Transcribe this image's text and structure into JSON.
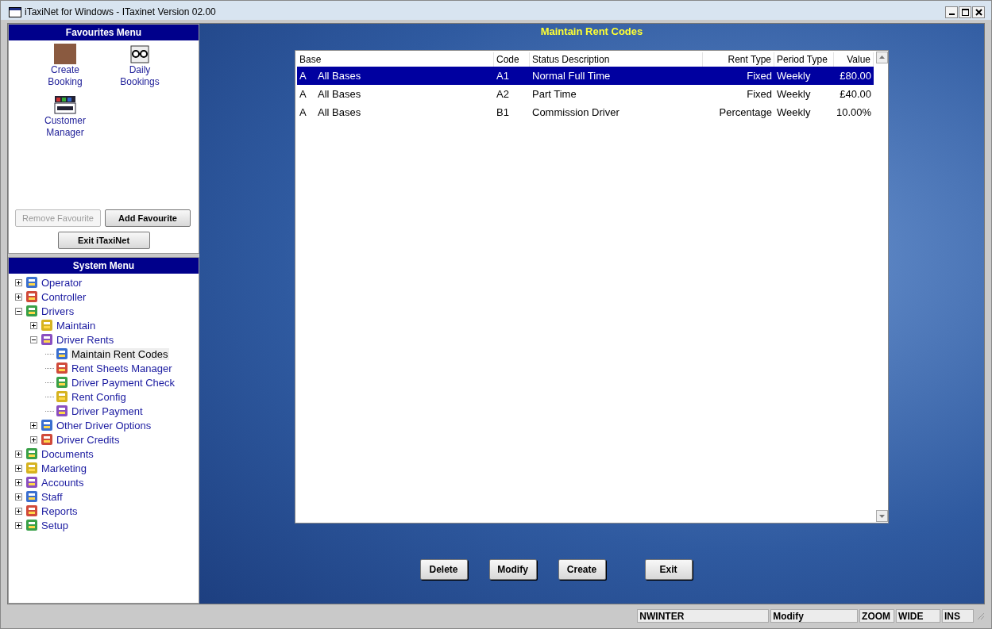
{
  "window": {
    "title": "iTaxiNet for Windows - ITaxinet Version 02.00"
  },
  "favourites": {
    "title": "Favourites Menu",
    "items": [
      {
        "label": "Create Booking",
        "kind": "photo"
      },
      {
        "label": "Daily Bookings",
        "kind": "glasses"
      },
      {
        "label": "Customer Manager",
        "kind": "index"
      }
    ],
    "buttons": [
      {
        "label": "Remove Favourite",
        "disabled": true
      },
      {
        "label": "Add Favourite",
        "disabled": false
      }
    ],
    "exit_button": "Exit iTaxiNet"
  },
  "system_menu": {
    "title": "System Menu",
    "items": [
      {
        "label": "Operator",
        "expanded": false,
        "selected": false
      },
      {
        "label": "Controller",
        "expanded": false,
        "selected": false
      },
      {
        "label": "Drivers",
        "expanded": true,
        "selected": false,
        "children": [
          {
            "label": "Maintain",
            "expanded": false,
            "selected": false
          },
          {
            "label": "Driver Rents",
            "expanded": true,
            "selected": false,
            "children": [
              {
                "label": "Maintain Rent Codes",
                "selected": true
              },
              {
                "label": "Rent Sheets Manager",
                "selected": false
              },
              {
                "label": "Driver Payment Check",
                "selected": false
              },
              {
                "label": "Rent Config",
                "selected": false
              },
              {
                "label": "Driver Payment",
                "selected": false
              }
            ]
          },
          {
            "label": "Other Driver Options",
            "expanded": false,
            "selected": false
          },
          {
            "label": "Driver Credits",
            "expanded": false,
            "selected": false
          }
        ]
      },
      {
        "label": "Documents",
        "expanded": false,
        "selected": false
      },
      {
        "label": "Marketing",
        "expanded": false,
        "selected": false
      },
      {
        "label": "Accounts",
        "expanded": false,
        "selected": false
      },
      {
        "label": "Staff",
        "expanded": false,
        "selected": false
      },
      {
        "label": "Reports",
        "expanded": false,
        "selected": false
      },
      {
        "label": "Setup",
        "expanded": false,
        "selected": false
      }
    ]
  },
  "main": {
    "title": "Maintain Rent Codes",
    "table": {
      "columns": [
        "Base",
        "Code",
        "Status Description",
        "Rent Type",
        "Period Type",
        "Value"
      ],
      "rows": [
        {
          "selected": true,
          "cells": [
            {
              "code": "A",
              "name": "All Bases"
            },
            "A1",
            "Normal Full Time",
            "Fixed",
            "Weekly",
            "£80.00"
          ]
        },
        {
          "selected": false,
          "cells": [
            {
              "code": "A",
              "name": "All Bases"
            },
            "A2",
            "Part Time",
            "Fixed",
            "Weekly",
            "£40.00"
          ]
        },
        {
          "selected": false,
          "cells": [
            {
              "code": "A",
              "name": "All Bases"
            },
            "B1",
            "Commission Driver",
            "Percentage",
            "Weekly",
            "10.00%"
          ]
        }
      ]
    },
    "buttons": [
      "Delete",
      "Modify",
      "Create",
      "Exit"
    ]
  },
  "status_bar": [
    "NWINTER",
    "Modify",
    "ZOOM",
    "WIDE",
    "INS"
  ]
}
